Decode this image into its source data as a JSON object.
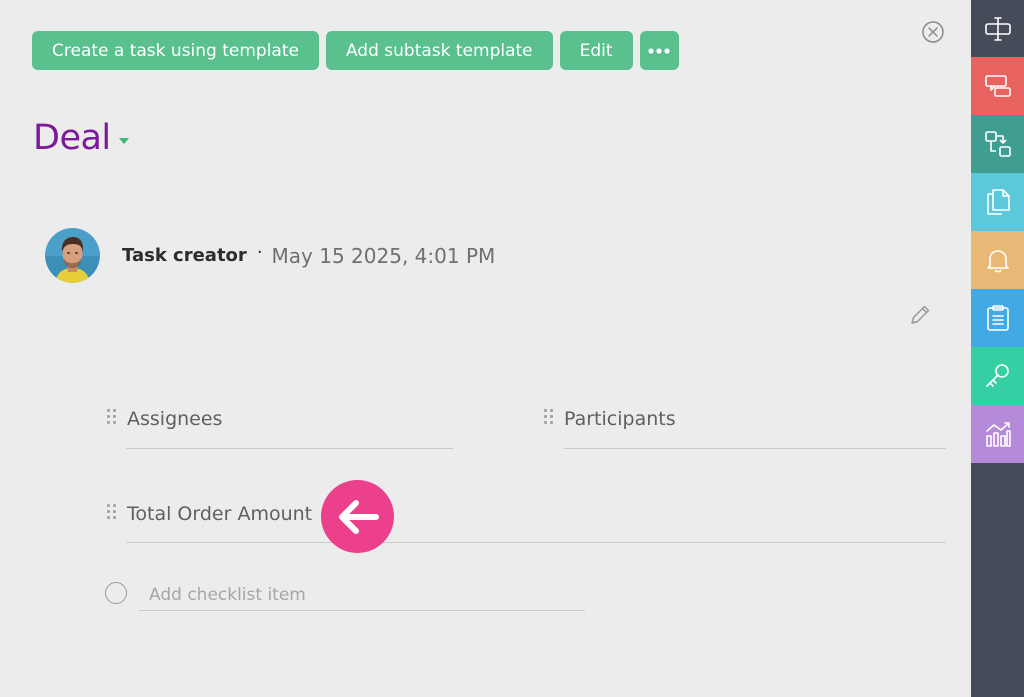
{
  "toolbar": {
    "create_from_template": "Create a task using template",
    "add_subtask_template": "Add subtask template",
    "edit": "Edit",
    "more_icon": "more-horizontal-icon"
  },
  "header": {
    "title": "Deal"
  },
  "meta": {
    "creator_label": "Task creator",
    "separator": "·",
    "date": "May 15 2025, 4:01 PM"
  },
  "fields": {
    "assignees": "Assignees",
    "participants": "Participants",
    "total_order_amount": "Total Order Amount"
  },
  "checklist": {
    "placeholder": "Add checklist item"
  },
  "colors": {
    "button_green": "#59c08e",
    "title_purple": "#7d1a9b",
    "arrow_pink": "#ec3f8c",
    "sidebar_bg": "#454b59",
    "side_1": "#454b59",
    "side_2": "#e8625f",
    "side_3": "#3f9e91",
    "side_4": "#5cc8dc",
    "side_5": "#e8b876",
    "side_6": "#41a9e3",
    "side_7": "#36cfa3",
    "side_8": "#b58ad9"
  },
  "sidebar": {
    "items": [
      {
        "icon": "text-cursor-icon"
      },
      {
        "icon": "chat-bubbles-icon"
      },
      {
        "icon": "workflow-icon"
      },
      {
        "icon": "documents-icon"
      },
      {
        "icon": "bell-icon"
      },
      {
        "icon": "clipboard-icon"
      },
      {
        "icon": "key-icon"
      },
      {
        "icon": "chart-icon"
      }
    ]
  }
}
